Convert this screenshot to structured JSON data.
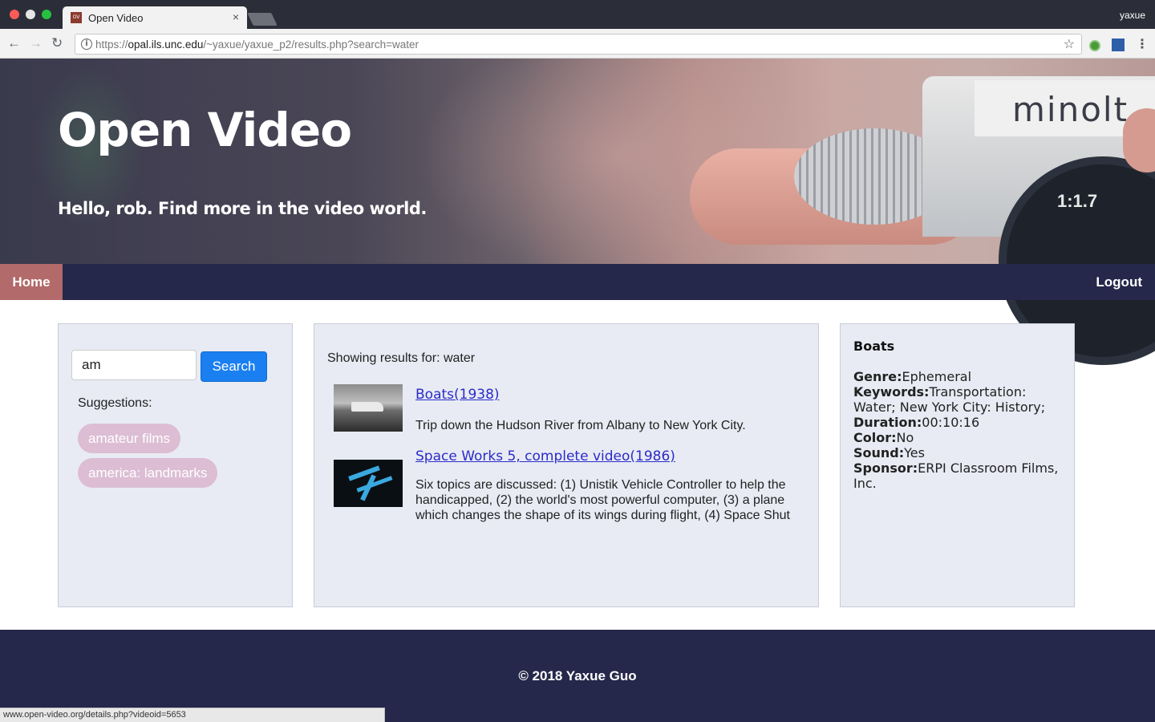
{
  "browser": {
    "tab_title": "Open Video",
    "tab_close": "×",
    "favicon_text": "OV",
    "profile_name": "yaxue",
    "url_prefix": "https://",
    "url_host": "opal.ils.unc.edu",
    "url_path": "/~yaxue/yaxue_p2/results.php?search=water",
    "icons": {
      "back": "arrow-left-icon",
      "forward": "arrow-right-icon",
      "reload": "reload-icon",
      "info": "info-icon",
      "star": "star-icon",
      "menu": "kebab-menu-icon"
    },
    "glyphs": {
      "back": "←",
      "forward": "→",
      "reload": "↻",
      "info": "i",
      "star": "☆",
      "menu": "⋮"
    }
  },
  "hero": {
    "title": "Open Video",
    "subtitle": "Hello, rob. Find more in the video world.",
    "camera_brand": "minolt",
    "lens_text": "1:1.7"
  },
  "nav": {
    "home_label": "Home",
    "logout_label": "Logout",
    "colors": {
      "bar": "#25284a",
      "active": "#b26a6a"
    }
  },
  "search_panel": {
    "input_value": "am",
    "button_label": "Search",
    "suggestions_label": "Suggestions:",
    "suggestions": [
      "amateur films",
      "america: landmarks"
    ]
  },
  "results_panel": {
    "heading": "Showing results for: water",
    "results": [
      {
        "title": "Boats(1938)",
        "description": "Trip down the Hudson River from Albany to New York City."
      },
      {
        "title": "Space Works 5, complete video(1986)",
        "description": "Six topics are discussed: (1) Unistik Vehicle Controller to help the handicapped, (2) the world's most powerful computer, (3) a plane which changes the shape of its wings during flight, (4) Space Shut"
      }
    ]
  },
  "detail_panel": {
    "title": "Boats",
    "fields": [
      {
        "label": "Genre:",
        "value": "Ephemeral"
      },
      {
        "label": "Keywords:",
        "value": "Transportation: Water; New York City: History;"
      },
      {
        "label": "Duration:",
        "value": "00:10:16"
      },
      {
        "label": "Color:",
        "value": "No"
      },
      {
        "label": "Sound:",
        "value": "Yes"
      },
      {
        "label": "Sponsor:",
        "value": "ERPI Classroom Films, Inc."
      }
    ]
  },
  "footer": {
    "text": "© 2018 Yaxue Guo"
  },
  "status_bar": {
    "text": "www.open-video.org/details.php?videoid=5653"
  },
  "colors": {
    "accent": "#1a7ff0",
    "chip": "#dcbdd4",
    "link": "#2b2bc9",
    "panel": "#e8ebf3"
  }
}
